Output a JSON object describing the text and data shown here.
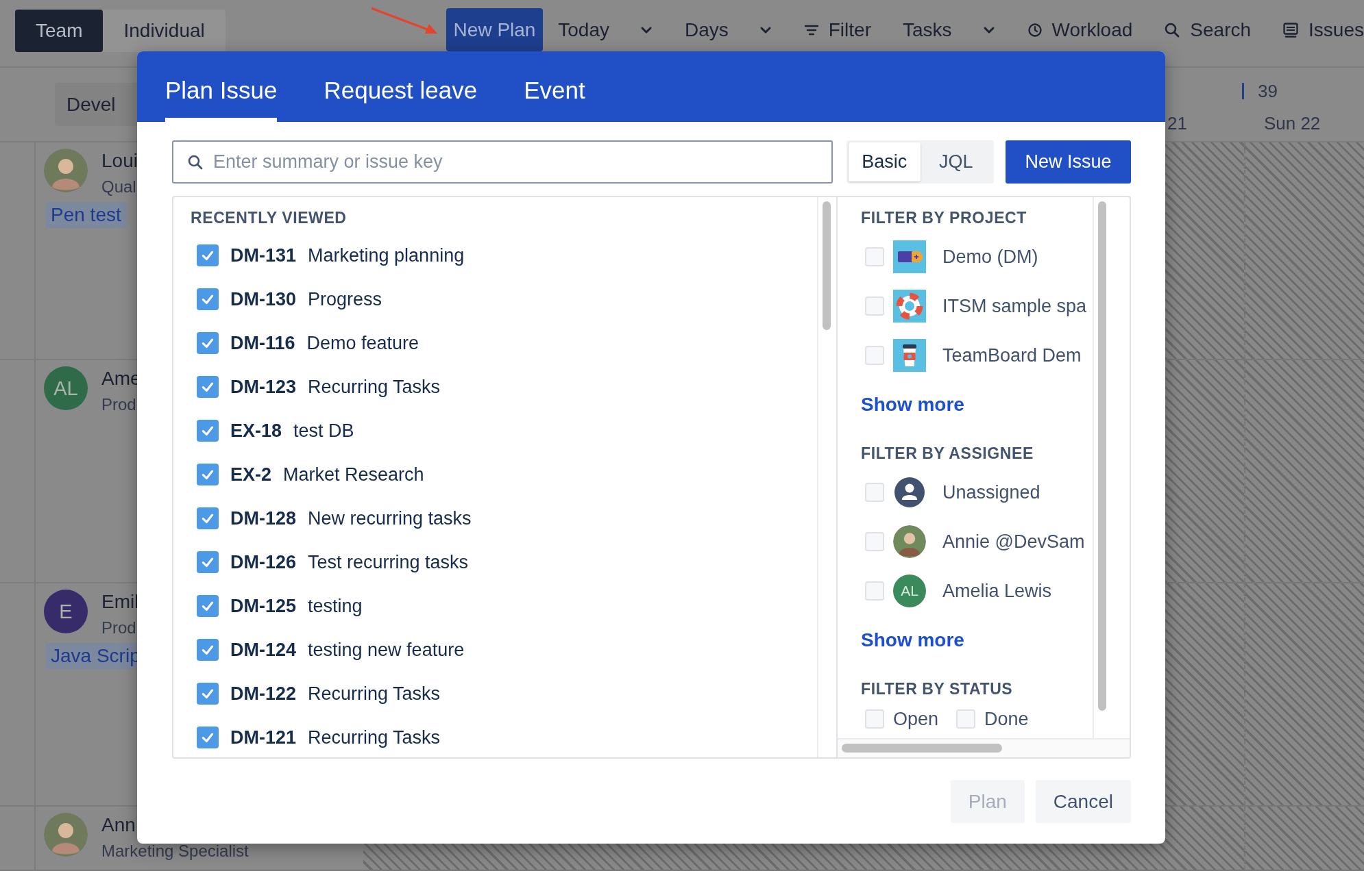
{
  "top_bar": {
    "view_toggle": [
      {
        "label": "Team",
        "selected": true
      },
      {
        "label": "Individual",
        "selected": false
      }
    ],
    "new_plan": "New Plan",
    "items": [
      {
        "label": "Today",
        "kind": "dropdown"
      },
      {
        "label": "Days",
        "kind": "dropdown"
      },
      {
        "label": "Filter",
        "kind": "filter"
      },
      {
        "label": "Tasks",
        "kind": "dropdown"
      },
      {
        "label": "Workload",
        "kind": "clock"
      },
      {
        "label": "Search",
        "kind": "search"
      },
      {
        "label": "Issues",
        "kind": "issues"
      }
    ]
  },
  "schedule": {
    "group_button": "Devel",
    "week": "39",
    "days": [
      "21",
      "Sun 22"
    ],
    "people": [
      {
        "name": "Loui",
        "role": "Qual",
        "avatar": {
          "kind": "photo"
        },
        "tag": "Pen test"
      },
      {
        "name": "Ame",
        "role": "Prod",
        "avatar": {
          "kind": "initials",
          "text": "AL",
          "color": "#2f6b48"
        }
      },
      {
        "name": "Emil",
        "role": "Prod",
        "avatar": {
          "kind": "initials",
          "text": "E",
          "color": "#382b6a"
        },
        "tag": "Java Scrip"
      },
      {
        "name": "Ann",
        "role": "Marketing Specialist",
        "avatar": {
          "kind": "photo"
        }
      }
    ]
  },
  "modal": {
    "tabs": [
      {
        "label": "Plan Issue",
        "selected": true
      },
      {
        "label": "Request leave",
        "selected": false
      },
      {
        "label": "Event",
        "selected": false
      }
    ],
    "search": {
      "placeholder": "Enter summary or issue key"
    },
    "mode": [
      {
        "label": "Basic",
        "selected": true
      },
      {
        "label": "JQL",
        "selected": false
      }
    ],
    "new_issue": "New Issue",
    "recent": {
      "title": "RECENTLY VIEWED",
      "issues": [
        {
          "key": "DM-131",
          "summary": "Marketing planning",
          "checked": true
        },
        {
          "key": "DM-130",
          "summary": "Progress",
          "checked": true
        },
        {
          "key": "DM-116",
          "summary": "Demo feature",
          "checked": true
        },
        {
          "key": "DM-123",
          "summary": "Recurring Tasks",
          "checked": true
        },
        {
          "key": "EX-18",
          "summary": "test DB",
          "checked": true
        },
        {
          "key": "EX-2",
          "summary": "Market Research",
          "checked": true
        },
        {
          "key": "DM-128",
          "summary": "New recurring tasks",
          "checked": true
        },
        {
          "key": "DM-126",
          "summary": "Test recurring tasks",
          "checked": true
        },
        {
          "key": "DM-125",
          "summary": "testing",
          "checked": true
        },
        {
          "key": "DM-124",
          "summary": "testing new feature",
          "checked": true
        },
        {
          "key": "DM-122",
          "summary": "Recurring Tasks",
          "checked": true
        },
        {
          "key": "DM-121",
          "summary": "Recurring Tasks",
          "checked": true
        }
      ]
    },
    "filters": [
      {
        "title": "FILTER BY PROJECT",
        "options": [
          {
            "label": "Demo (DM)",
            "kind": "battery",
            "checked": false
          },
          {
            "label": "ITSM sample spa",
            "kind": "lifebuoy",
            "checked": false
          },
          {
            "label": "TeamBoard Dem",
            "kind": "cup",
            "checked": false
          }
        ],
        "show_more": "Show more"
      },
      {
        "title": "FILTER BY ASSIGNEE",
        "options": [
          {
            "label": "Unassigned",
            "kind": "user",
            "checked": false
          },
          {
            "label": "Annie @DevSam",
            "kind": "photo",
            "checked": false
          },
          {
            "label": "Amelia Lewis",
            "kind": "initials",
            "initials": "AL",
            "color": "#3a8a5c",
            "checked": false
          }
        ],
        "show_more": "Show more"
      },
      {
        "title": "FILTER BY STATUS",
        "options": [
          {
            "label": "Open",
            "kind": "status",
            "checked": false
          },
          {
            "label": "Done",
            "kind": "status",
            "checked": false
          }
        ]
      }
    ],
    "actions": [
      {
        "label": "Plan",
        "disabled": true
      },
      {
        "label": "Cancel",
        "disabled": false
      }
    ]
  }
}
